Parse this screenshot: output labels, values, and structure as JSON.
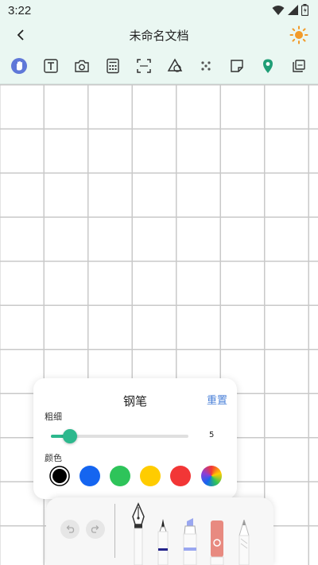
{
  "status": {
    "time": "3:22"
  },
  "header": {
    "title": "未命名文档"
  },
  "toolbar": {
    "items": [
      "hand-icon",
      "text-icon",
      "camera-icon",
      "calculator-icon",
      "ocr-scan-icon",
      "shapes-icon",
      "dots-icon",
      "sticky-note-icon",
      "location-pin-icon",
      "gallery-icon"
    ]
  },
  "pen_panel": {
    "title": "钢笔",
    "reset_label": "重置",
    "thickness_label": "粗细",
    "thickness_value": "5",
    "thickness_fraction": 0.14,
    "color_label": "颜色",
    "colors": [
      "#000000",
      "#1565f0",
      "#2ec45a",
      "#ffcc00",
      "#f23636",
      "rainbow"
    ],
    "selected_color": "#000000"
  },
  "bottom_tools": [
    "undo-icon",
    "redo-icon",
    "fountain-pen-icon",
    "ballpoint-pen-icon",
    "highlighter-icon",
    "eraser-icon",
    "pencil-icon"
  ]
}
